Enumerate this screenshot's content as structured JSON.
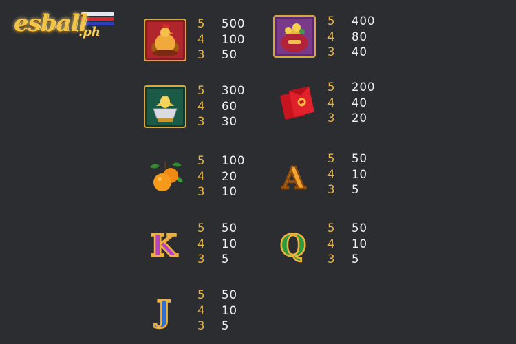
{
  "logo": {
    "main": "esball",
    "sub": ".ph"
  },
  "paytable": [
    {
      "symbol": "golden-rooster",
      "pays": [
        {
          "n": "5",
          "v": "500"
        },
        {
          "n": "4",
          "v": "100"
        },
        {
          "n": "3",
          "v": "50"
        }
      ]
    },
    {
      "symbol": "treasure-bag",
      "pays": [
        {
          "n": "5",
          "v": "400"
        },
        {
          "n": "4",
          "v": "80"
        },
        {
          "n": "3",
          "v": "40"
        }
      ]
    },
    {
      "symbol": "gold-ingot",
      "pays": [
        {
          "n": "5",
          "v": "300"
        },
        {
          "n": "4",
          "v": "60"
        },
        {
          "n": "3",
          "v": "30"
        }
      ]
    },
    {
      "symbol": "red-envelope",
      "pays": [
        {
          "n": "5",
          "v": "200"
        },
        {
          "n": "4",
          "v": "40"
        },
        {
          "n": "3",
          "v": "20"
        }
      ]
    },
    {
      "symbol": "oranges",
      "pays": [
        {
          "n": "5",
          "v": "100"
        },
        {
          "n": "4",
          "v": "20"
        },
        {
          "n": "3",
          "v": "10"
        }
      ]
    },
    {
      "symbol": "letter-a",
      "pays": [
        {
          "n": "5",
          "v": "50"
        },
        {
          "n": "4",
          "v": "10"
        },
        {
          "n": "3",
          "v": "5"
        }
      ]
    },
    {
      "symbol": "letter-k",
      "pays": [
        {
          "n": "5",
          "v": "50"
        },
        {
          "n": "4",
          "v": "10"
        },
        {
          "n": "3",
          "v": "5"
        }
      ]
    },
    {
      "symbol": "letter-q",
      "pays": [
        {
          "n": "5",
          "v": "50"
        },
        {
          "n": "4",
          "v": "10"
        },
        {
          "n": "3",
          "v": "5"
        }
      ]
    },
    {
      "symbol": "letter-j",
      "pays": [
        {
          "n": "5",
          "v": "50"
        },
        {
          "n": "4",
          "v": "10"
        },
        {
          "n": "3",
          "v": "5"
        }
      ]
    }
  ],
  "colors": {
    "background": "#2b2d31",
    "count": "#e9b63b",
    "payout": "#f2f2f2"
  }
}
